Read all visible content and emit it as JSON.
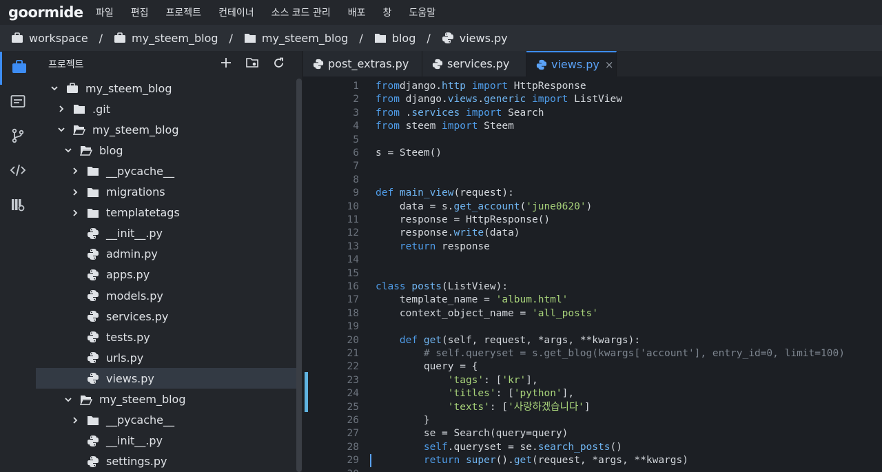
{
  "app": {
    "logo": "goormide"
  },
  "menu": [
    "파일",
    "편집",
    "프로젝트",
    "컨테이너",
    "소스 코드 관리",
    "배포",
    "창",
    "도움말"
  ],
  "breadcrumb": [
    "workspace",
    "my_steem_blog",
    "my_steem_blog",
    "blog",
    "views.py"
  ],
  "breadcrumb_sep": "/",
  "sidebar": {
    "title": "프로젝트",
    "tree": [
      {
        "label": "my_steem_blog",
        "type": "folder-root",
        "open": true
      },
      {
        "label": ".git",
        "type": "folder",
        "open": false
      },
      {
        "label": "my_steem_blog",
        "type": "folder",
        "open": true
      },
      {
        "label": "blog",
        "type": "folder",
        "open": true
      },
      {
        "label": "__pycache__",
        "type": "folder",
        "open": false
      },
      {
        "label": "migrations",
        "type": "folder",
        "open": false
      },
      {
        "label": "templatetags",
        "type": "folder",
        "open": false
      },
      {
        "label": "__init__.py",
        "type": "python"
      },
      {
        "label": "admin.py",
        "type": "python"
      },
      {
        "label": "apps.py",
        "type": "python"
      },
      {
        "label": "models.py",
        "type": "python"
      },
      {
        "label": "services.py",
        "type": "python"
      },
      {
        "label": "tests.py",
        "type": "python"
      },
      {
        "label": "urls.py",
        "type": "python"
      },
      {
        "label": "views.py",
        "type": "python",
        "selected": true
      },
      {
        "label": "my_steem_blog",
        "type": "folder",
        "open": true
      },
      {
        "label": "__pycache__",
        "type": "folder",
        "open": false
      },
      {
        "label": "__init__.py",
        "type": "python"
      },
      {
        "label": "settings.py",
        "type": "python"
      }
    ]
  },
  "tabs": [
    {
      "label": "post_extras.py",
      "active": false
    },
    {
      "label": "services.py",
      "active": false
    },
    {
      "label": "views.py",
      "active": true,
      "close": "×"
    }
  ],
  "editor": {
    "lines": [
      [
        [
          "kw",
          "from"
        ],
        [
          "",
          "django"
        ],
        [
          "",
          "."
        ],
        [
          "fn",
          "http"
        ],
        [
          "",
          ""
        ],
        [
          "kw",
          " import"
        ],
        [
          "",
          " HttpResponse"
        ]
      ],
      [
        [
          "kw",
          "from"
        ],
        [
          "",
          " django."
        ],
        [
          "fn",
          "views"
        ],
        [
          "",
          "."
        ],
        [
          "fn",
          "generic"
        ],
        [
          "kw",
          " import"
        ],
        [
          "",
          " ListView"
        ]
      ],
      [
        [
          "kw",
          "from"
        ],
        [
          "",
          " ."
        ],
        [
          "fn",
          "services"
        ],
        [
          "kw",
          " import"
        ],
        [
          "",
          " Search"
        ]
      ],
      [
        [
          "kw",
          "from"
        ],
        [
          "",
          " steem"
        ],
        [
          "kw",
          " import"
        ],
        [
          "",
          " Steem"
        ]
      ],
      [],
      [
        [
          "",
          "s = Steem()"
        ]
      ],
      [],
      [],
      [
        [
          "kw",
          "def"
        ],
        [
          "fn",
          " main_view"
        ],
        [
          "",
          "(request):"
        ]
      ],
      [
        [
          "",
          "    data = s."
        ],
        [
          "fn",
          "get_account"
        ],
        [
          "",
          "("
        ],
        [
          "st",
          "'june0620'"
        ],
        [
          "",
          ")"
        ]
      ],
      [
        [
          "",
          "    response = HttpResponse()"
        ]
      ],
      [
        [
          "",
          "    response."
        ],
        [
          "fn",
          "write"
        ],
        [
          "",
          "(data)"
        ]
      ],
      [
        [
          "kw",
          "    return"
        ],
        [
          "",
          " response"
        ]
      ],
      [],
      [],
      [
        [
          "kw",
          "class"
        ],
        [
          "fn",
          " posts"
        ],
        [
          "",
          "(ListView):"
        ]
      ],
      [
        [
          "",
          "    template_name = "
        ],
        [
          "st",
          "'album.html'"
        ]
      ],
      [
        [
          "",
          "    context_object_name = "
        ],
        [
          "st",
          "'all_posts'"
        ]
      ],
      [],
      [
        [
          "kw",
          "    def"
        ],
        [
          "fn",
          " get"
        ],
        [
          "",
          "(self, request, *args, **kwargs):"
        ]
      ],
      [
        [
          "cm",
          "        # self.queryset = s.get_blog(kwargs['account'], entry_id=0, limit=100)"
        ]
      ],
      [
        [
          "",
          "        query = {"
        ]
      ],
      [
        [
          "st",
          "            'tags'"
        ],
        [
          "",
          ": ["
        ],
        [
          "st",
          "'kr'"
        ],
        [
          "",
          "],"
        ]
      ],
      [
        [
          "st",
          "            'titles'"
        ],
        [
          "",
          ": ["
        ],
        [
          "st",
          "'python'"
        ],
        [
          "",
          "],"
        ]
      ],
      [
        [
          "st",
          "            'texts'"
        ],
        [
          "",
          ": ["
        ],
        [
          "st",
          "'사랑하겠습니다'"
        ],
        [
          "",
          "]"
        ]
      ],
      [
        [
          "",
          "        }"
        ]
      ],
      [
        [
          "",
          "        se = Search(query=query)"
        ]
      ],
      [
        [
          "kw",
          "        self"
        ],
        [
          "",
          ".queryset = se."
        ],
        [
          "fn",
          "search_posts"
        ],
        [
          "",
          "()"
        ]
      ],
      [
        [
          "kw",
          "        return"
        ],
        [
          "fn",
          " super"
        ],
        [
          "",
          "()."
        ],
        [
          "fn",
          "get"
        ],
        [
          "",
          "(request, *args, **kwargs)"
        ]
      ],
      []
    ]
  },
  "colors": {
    "accent": "#3d8df5",
    "keyword": "#4f9ce8",
    "string": "#a8d37a",
    "comment": "#7d858f"
  }
}
